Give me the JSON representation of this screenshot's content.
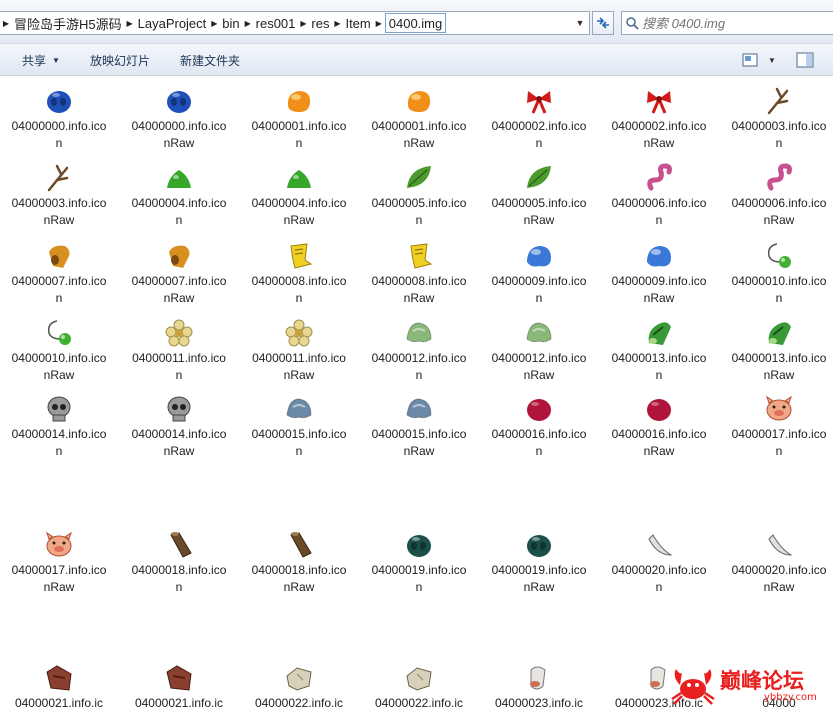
{
  "address_bar": {
    "crumbs": [
      "冒险岛手游H5源码",
      "LayaProject",
      "bin",
      "res001",
      "res",
      "Item"
    ],
    "current_folder": "0400.img"
  },
  "search": {
    "placeholder": "搜索 0400.img"
  },
  "toolbar": {
    "share_label": "共享",
    "slideshow_label": "放映幻灯片",
    "new_folder_label": "新建文件夹"
  },
  "files": [
    {
      "name": "04000000.info.icon",
      "icon": "blue-blob-icon",
      "color": "#1f4fb8"
    },
    {
      "name": "04000000.info.iconRaw",
      "icon": "blue-blob-icon",
      "color": "#1f4fb8"
    },
    {
      "name": "04000001.info.icon",
      "icon": "orange-stone-icon",
      "color": "#f0901a"
    },
    {
      "name": "04000001.info.iconRaw",
      "icon": "orange-stone-icon",
      "color": "#f0901a"
    },
    {
      "name": "04000002.info.icon",
      "icon": "red-bow-icon",
      "color": "#d11a1a"
    },
    {
      "name": "04000002.info.iconRaw",
      "icon": "red-bow-icon",
      "color": "#d11a1a"
    },
    {
      "name": "04000003.info.icon",
      "icon": "twig-icon",
      "color": "#6b4a2a"
    },
    {
      "name": "04000003.info.iconRaw",
      "icon": "twig-icon",
      "color": "#6b4a2a"
    },
    {
      "name": "04000004.info.icon",
      "icon": "green-slime-icon",
      "color": "#35a82a"
    },
    {
      "name": "04000004.info.iconRaw",
      "icon": "green-slime-icon",
      "color": "#35a82a"
    },
    {
      "name": "04000005.info.icon",
      "icon": "leaf-icon",
      "color": "#4c9a2e"
    },
    {
      "name": "04000005.info.iconRaw",
      "icon": "leaf-icon",
      "color": "#4c9a2e"
    },
    {
      "name": "04000006.info.icon",
      "icon": "pink-worm-icon",
      "color": "#c8508e"
    },
    {
      "name": "04000006.info.iconRaw",
      "icon": "pink-worm-icon",
      "color": "#c8508e"
    },
    {
      "name": "04000007.info.icon",
      "icon": "mushroom-cap-icon",
      "color": "#d89020"
    },
    {
      "name": "04000007.info.iconRaw",
      "icon": "mushroom-cap-icon",
      "color": "#d89020"
    },
    {
      "name": "04000008.info.icon",
      "icon": "yellow-scroll-icon",
      "color": "#f0d020"
    },
    {
      "name": "04000008.info.iconRaw",
      "icon": "yellow-scroll-icon",
      "color": "#f0d020"
    },
    {
      "name": "04000009.info.icon",
      "icon": "blue-jelly-icon",
      "color": "#3a78d8"
    },
    {
      "name": "04000009.info.iconRaw",
      "icon": "blue-jelly-icon",
      "color": "#3a78d8"
    },
    {
      "name": "04000010.info.icon",
      "icon": "green-orb-string-icon",
      "color": "#40b030"
    },
    {
      "name": "04000010.info.iconRaw",
      "icon": "green-orb-string-icon",
      "color": "#40b030"
    },
    {
      "name": "04000011.info.icon",
      "icon": "flower-icon",
      "color": "#e8d890"
    },
    {
      "name": "04000011.info.iconRaw",
      "icon": "flower-icon",
      "color": "#e8d890"
    },
    {
      "name": "04000012.info.icon",
      "icon": "green-shell-icon",
      "color": "#8ab878"
    },
    {
      "name": "04000012.info.iconRaw",
      "icon": "green-shell-icon",
      "color": "#8ab878"
    },
    {
      "name": "04000013.info.icon",
      "icon": "green-pod-icon",
      "color": "#3a9a38"
    },
    {
      "name": "04000013.info.iconRaw",
      "icon": "green-pod-icon",
      "color": "#3a9a38"
    },
    {
      "name": "04000014.info.icon",
      "icon": "skull-icon",
      "color": "#9a9a9a"
    },
    {
      "name": "04000014.info.iconRaw",
      "icon": "skull-icon",
      "color": "#9a9a9a"
    },
    {
      "name": "04000015.info.icon",
      "icon": "blue-gray-shell-icon",
      "color": "#6a8aa8"
    },
    {
      "name": "04000015.info.iconRaw",
      "icon": "blue-gray-shell-icon",
      "color": "#6a8aa8"
    },
    {
      "name": "04000016.info.icon",
      "icon": "crimson-orb-icon",
      "color": "#b0143a"
    },
    {
      "name": "04000016.info.iconRaw",
      "icon": "crimson-orb-icon",
      "color": "#b0143a"
    },
    {
      "name": "04000017.info.icon",
      "icon": "pig-face-icon",
      "color": "#f0a888"
    },
    {
      "name": "04000017.info.iconRaw",
      "icon": "pig-face-icon",
      "color": "#f0a888"
    },
    {
      "name": "04000018.info.icon",
      "icon": "brown-log-icon",
      "color": "#6a4a2a"
    },
    {
      "name": "04000018.info.iconRaw",
      "icon": "brown-log-icon",
      "color": "#6a4a2a"
    },
    {
      "name": "04000019.info.icon",
      "icon": "dark-green-blob-icon",
      "color": "#1a5048"
    },
    {
      "name": "04000019.info.iconRaw",
      "icon": "dark-green-blob-icon",
      "color": "#1a5048"
    },
    {
      "name": "04000020.info.icon",
      "icon": "white-fang-icon",
      "color": "#e0e0e0"
    },
    {
      "name": "04000020.info.iconRaw",
      "icon": "white-fang-icon",
      "color": "#e0e0e0"
    },
    {
      "name": "04000021.info.ic",
      "icon": "brown-cloth-icon",
      "color": "#8a4030"
    },
    {
      "name": "04000021.info.ic",
      "icon": "brown-cloth-icon",
      "color": "#8a4030"
    },
    {
      "name": "04000022.info.ic",
      "icon": "stone-block-icon",
      "color": "#d8d0b8"
    },
    {
      "name": "04000022.info.ic",
      "icon": "stone-block-icon",
      "color": "#d8d0b8"
    },
    {
      "name": "04000023.info.ic",
      "icon": "bone-icon",
      "color": "#e8e4e0"
    },
    {
      "name": "04000023.info.ic",
      "icon": "bone-icon",
      "color": "#e8e4e0"
    },
    {
      "name": "04000",
      "icon": "partial-icon",
      "color": "#ffffff"
    }
  ],
  "watermark": {
    "text": "巅峰论坛",
    "sub": "ybbzy.com"
  }
}
